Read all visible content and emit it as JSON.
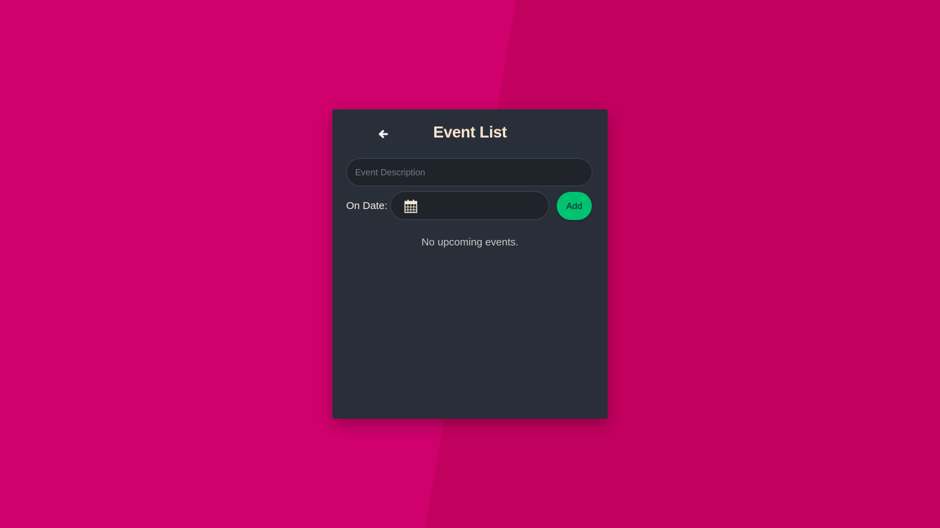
{
  "app": {
    "title": "Event List"
  },
  "form": {
    "description_placeholder": "Event Description",
    "description_value": "",
    "date_label": "On Date:",
    "date_value": "",
    "add_label": "Add"
  },
  "events": {
    "empty_message": "No upcoming events.",
    "items": []
  },
  "icons": {
    "back": "arrow-left-icon",
    "calendar": "calendar-icon"
  },
  "colors": {
    "background": "#d0006c",
    "background_shape": "#c2015f",
    "card": "#282f38",
    "title": "#fbe3cf",
    "accent": "#00c271"
  }
}
